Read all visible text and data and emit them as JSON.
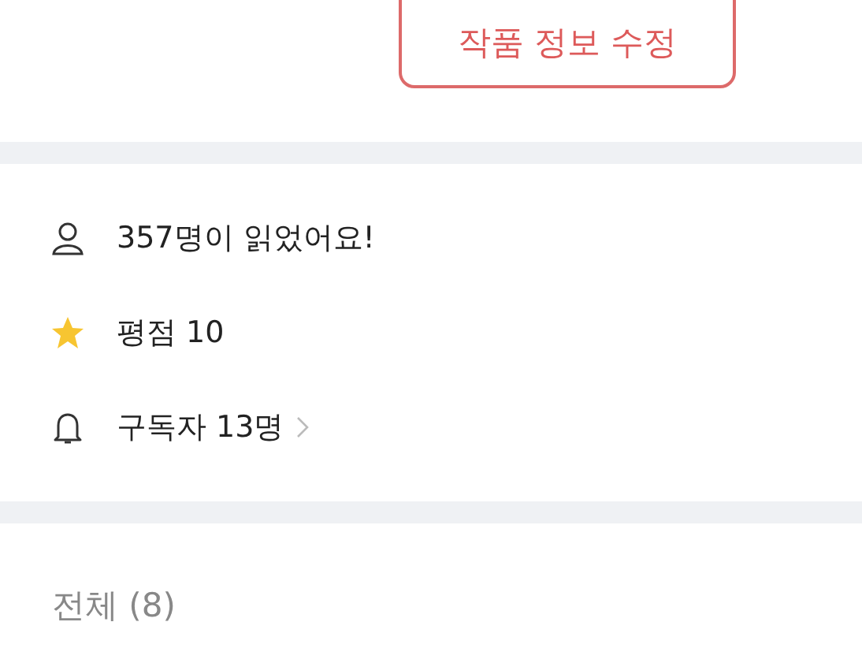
{
  "edit_button": {
    "label": "작품 정보 수정"
  },
  "stats": [
    {
      "kind": "readers",
      "label": "357명이 읽었어요!",
      "link": false
    },
    {
      "kind": "rating",
      "label": "평점 10",
      "link": false
    },
    {
      "kind": "subscribers",
      "label": "구독자 13명",
      "link": true
    }
  ],
  "episodes": {
    "heading": "전체 (8)"
  }
}
